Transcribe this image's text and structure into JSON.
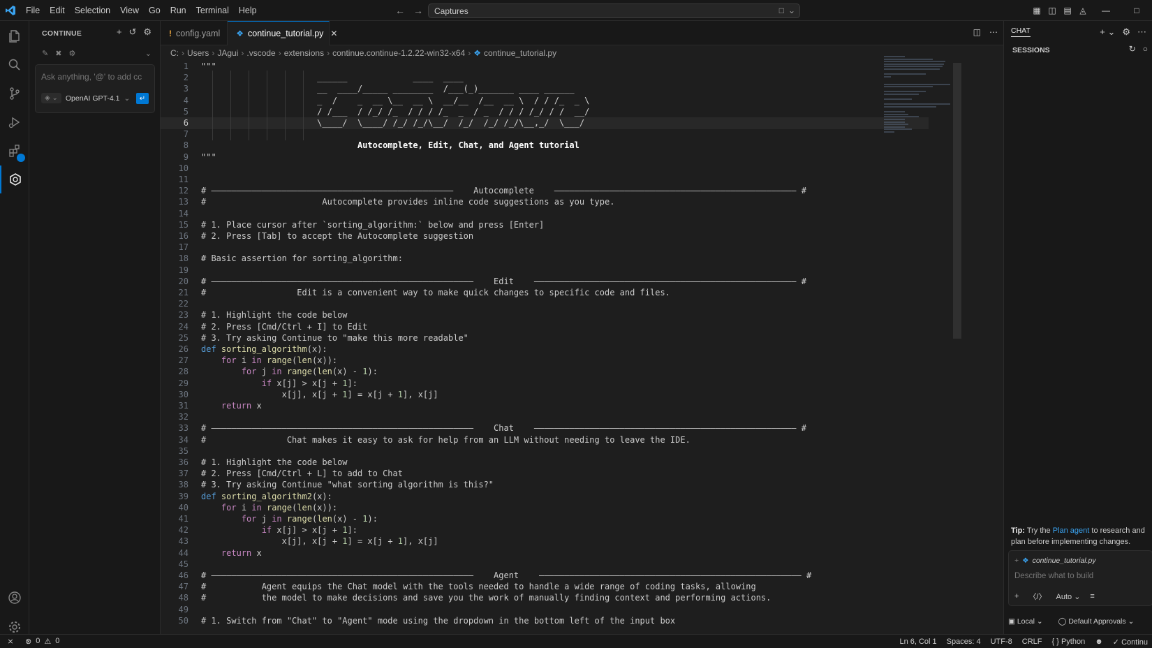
{
  "titlebar": {
    "menu": [
      "File",
      "Edit",
      "Selection",
      "View",
      "Go",
      "Run",
      "Terminal",
      "Help"
    ],
    "command_center": "Captures"
  },
  "sidebar": {
    "header": "CONTINUE",
    "input_placeholder": "Ask anything, '@' to add cc",
    "model": "OpenAI GPT-4.1"
  },
  "tabs": [
    {
      "label": "config.yaml",
      "icon": "yaml-file-icon",
      "active": false
    },
    {
      "label": "continue_tutorial.py",
      "icon": "python-file-icon",
      "active": true
    }
  ],
  "breadcrumb": [
    "C:",
    "Users",
    "JAgui",
    ".vscode",
    "extensions",
    "continue.continue-1.2.22-win32-x64",
    "continue_tutorial.py"
  ],
  "code_lines": [
    "\"\"\"",
    "                       ______             ____  ____",
    "                       __  ____/_____ ________  /___(_)_______ ____ ______",
    "                       _  /    _  __ \\__  __ \\  __/__  /__  __ \\  / / /_  _ \\",
    "                       / /___  / /_/ /_  / / / /_  _  / _  / / / /_/ / /  __/",
    "                       \\____/  \\____/ /_/ /_/\\__/  /_/  /_/ /_/\\__,_/  \\___/",
    "",
    "                               Autocomplete, Edit, Chat, and Agent tutorial",
    "\"\"\"",
    "",
    "",
    "# ————————————————————————————————————————————————    Autocomplete    ———————————————————————————————————————————————— #",
    "#                       Autocomplete provides inline code suggestions as you type.",
    "",
    "# 1. Place cursor after `sorting_algorithm:` below and press [Enter]",
    "# 2. Press [Tab] to accept the Autocomplete suggestion",
    "",
    "# Basic assertion for sorting_algorithm:",
    "",
    "# ————————————————————————————————————————————————————    Edit    ———————————————————————————————————————————————————— #",
    "#                  Edit is a convenient way to make quick changes to specific code and files.",
    "",
    "# 1. Highlight the code below",
    "# 2. Press [Cmd/Ctrl + I] to Edit",
    "# 3. Try asking Continue to \"make this more readable\"",
    "def sorting_algorithm(x):",
    "    for i in range(len(x)):",
    "        for j in range(len(x) - 1):",
    "            if x[j] > x[j + 1]:",
    "                x[j], x[j + 1] = x[j + 1], x[j]",
    "    return x",
    "",
    "# ————————————————————————————————————————————————————    Chat    ———————————————————————————————————————————————————— #",
    "#                Chat makes it easy to ask for help from an LLM without needing to leave the IDE.",
    "",
    "# 1. Highlight the code below",
    "# 2. Press [Cmd/Ctrl + L] to add to Chat",
    "# 3. Try asking Continue \"what sorting algorithm is this?\"",
    "def sorting_algorithm2(x):",
    "    for i in range(len(x)):",
    "        for j in range(len(x) - 1):",
    "            if x[j] > x[j + 1]:",
    "                x[j], x[j + 1] = x[j + 1], x[j]",
    "    return x",
    "",
    "# ————————————————————————————————————————————————————    Agent    ———————————————————————————————————————————————————— #",
    "#           Agent equips the Chat model with the tools needed to handle a wide range of coding tasks, allowing",
    "#           the model to make decisions and save you the work of manually finding context and performing actions.",
    "",
    "# 1. Switch from \"Chat\" to \"Agent\" mode using the dropdown in the bottom left of the input box"
  ],
  "current_line": 6,
  "chat": {
    "tab": "CHAT",
    "sessions_title": "SESSIONS",
    "tip_label": "Tip:",
    "tip_pre": "Try the",
    "tip_link": "Plan agent",
    "tip_post": "to research and plan before implementing changes.",
    "attached_file": "continue_tutorial.py",
    "input_placeholder": "Describe what to build",
    "mode": "Auto",
    "location": "Local",
    "approvals": "Default Approvals"
  },
  "statusbar": {
    "errors": "0",
    "warnings": "0",
    "position": "Ln 6, Col 1",
    "spaces": "Spaces: 4",
    "encoding": "UTF-8",
    "eol": "CRLF",
    "language": "Python",
    "extension": "Continu"
  },
  "colors": {
    "accent": "#0078d4",
    "background": "#1e1e1e",
    "sidebar": "#181818"
  }
}
